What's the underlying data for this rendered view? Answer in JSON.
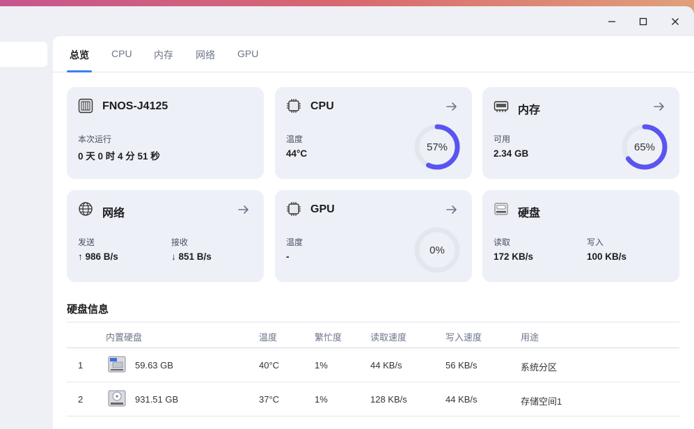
{
  "tabs": [
    {
      "label": "总览",
      "active": true
    },
    {
      "label": "CPU"
    },
    {
      "label": "内存"
    },
    {
      "label": "网络"
    },
    {
      "label": "GPU"
    }
  ],
  "colors": {
    "accent": "#3d7cf2",
    "ring": "#5a55f0",
    "ring_track": "#e4e6ee"
  },
  "cards": {
    "device": {
      "icon": "motherboard-icon",
      "title": "FNOS-J4125",
      "uptime_label": "本次运行",
      "uptime_value": "0 天 0 时 4 分 51 秒"
    },
    "cpu": {
      "icon": "cpu-chip-icon",
      "title": "CPU",
      "temp_label": "温度",
      "temp_value": "44°C",
      "usage_text": "57%",
      "usage": 0.57
    },
    "memory": {
      "icon": "ram-icon",
      "title": "内存",
      "avail_label": "可用",
      "avail_value": "2.34 GB",
      "usage_text": "65%",
      "usage": 0.65
    },
    "network": {
      "icon": "globe-icon",
      "title": "网络",
      "send_label": "发送",
      "send_value": "↑ 986 B/s",
      "recv_label": "接收",
      "recv_value": "↓ 851 B/s"
    },
    "gpu": {
      "icon": "gpu-chip-icon",
      "title": "GPU",
      "temp_label": "温度",
      "temp_value": "-",
      "usage_text": "0%",
      "usage": 0
    },
    "disk": {
      "icon": "hard-disk-icon",
      "title": "硬盘",
      "read_label": "读取",
      "read_value": "172 KB/s",
      "write_label": "写入",
      "write_value": "100 KB/s"
    }
  },
  "disk_info": {
    "title": "硬盘信息",
    "headers": [
      "内置硬盘",
      "温度",
      "繁忙度",
      "读取速度",
      "写入速度",
      "用途"
    ],
    "rows": [
      {
        "index": "1",
        "icon": "ssd-icon",
        "size": "59.63 GB",
        "temp": "40°C",
        "busy": "1%",
        "read": "44 KB/s",
        "write": "56 KB/s",
        "usage": "系统分区"
      },
      {
        "index": "2",
        "icon": "hdd-icon",
        "size": "931.51 GB",
        "temp": "37°C",
        "busy": "1%",
        "read": "128 KB/s",
        "write": "44 KB/s",
        "usage": "存储空间1"
      }
    ]
  }
}
